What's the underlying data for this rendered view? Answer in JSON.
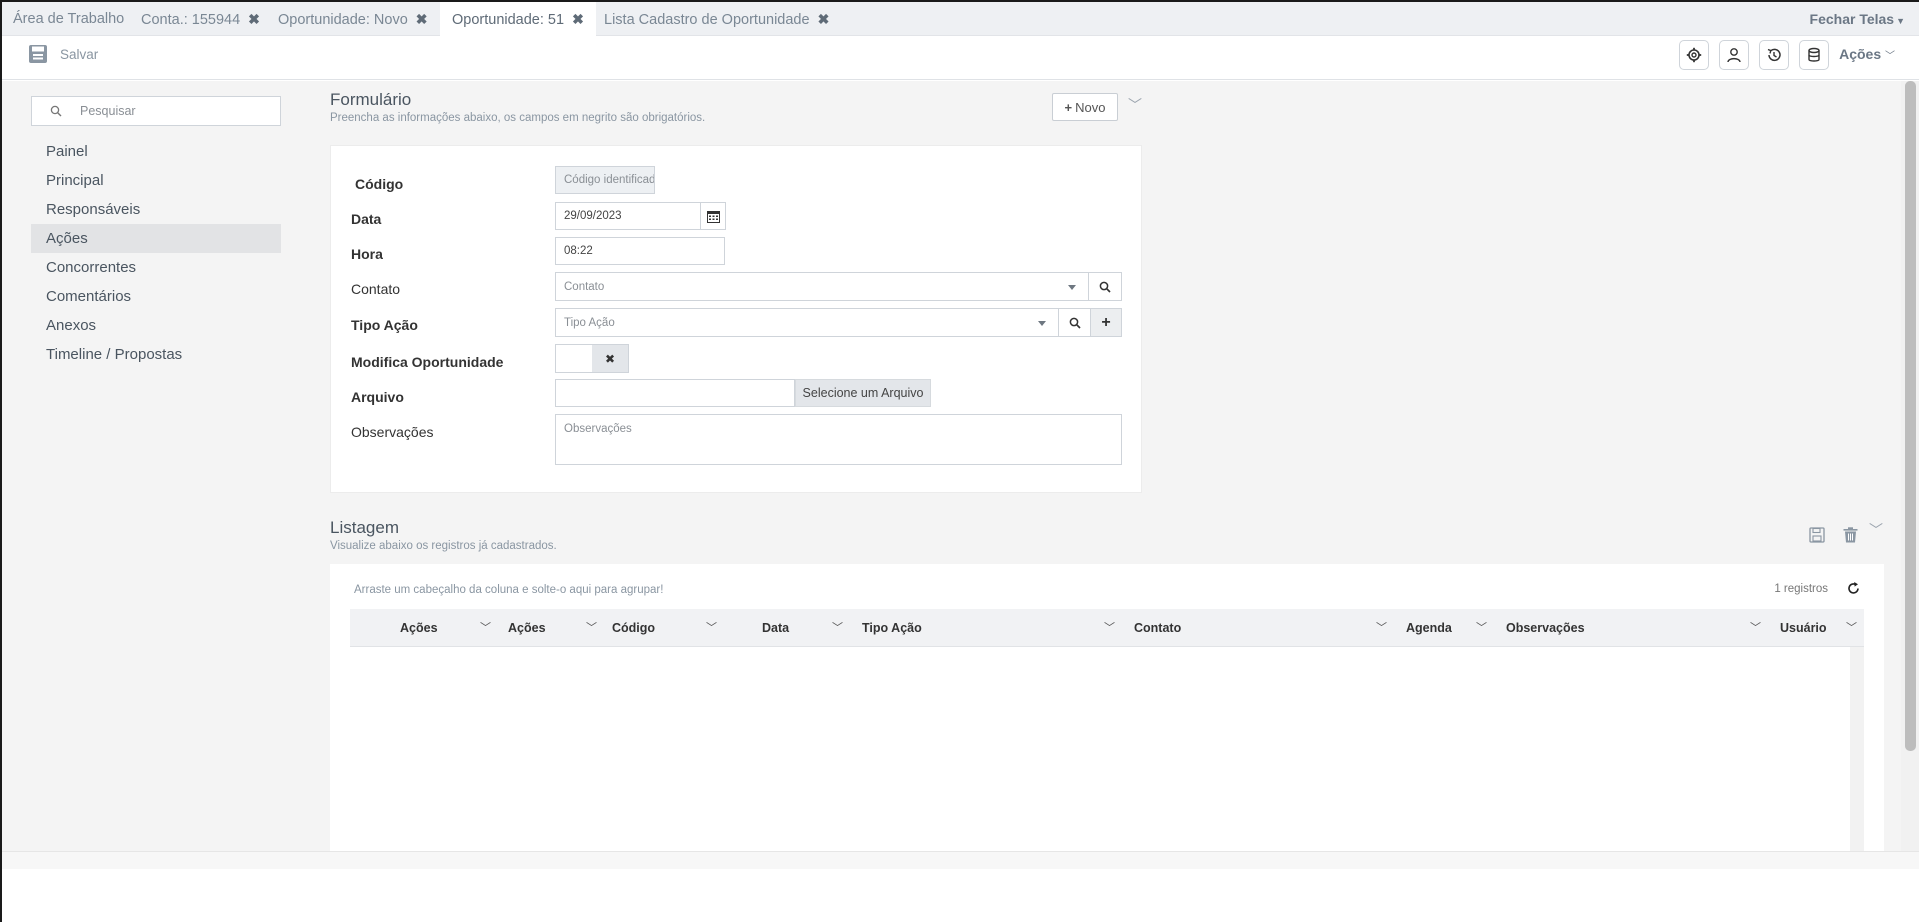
{
  "tabs": [
    {
      "label": "Área de Trabalho",
      "closable": false,
      "active": false
    },
    {
      "label": "Conta.: 155944",
      "closable": true,
      "active": false
    },
    {
      "label": "Oportunidade: Novo",
      "closable": true,
      "active": false
    },
    {
      "label": "Oportunidade: 51",
      "closable": true,
      "active": true
    },
    {
      "label": "Lista Cadastro de Oportunidade",
      "closable": true,
      "active": false
    }
  ],
  "close_all_label": "Fechar Telas",
  "toolbar": {
    "save_label": "Salvar",
    "icons": [
      "gear-icon",
      "user-icon",
      "history-icon",
      "database-icon"
    ],
    "actions_label": "Ações"
  },
  "sidebar": {
    "search_placeholder": "Pesquisar",
    "items": [
      {
        "label": "Painel",
        "active": false
      },
      {
        "label": "Principal",
        "active": false
      },
      {
        "label": "Responsáveis",
        "active": false
      },
      {
        "label": "Ações",
        "active": true
      },
      {
        "label": "Concorrentes",
        "active": false
      },
      {
        "label": "Comentários",
        "active": false
      },
      {
        "label": "Anexos",
        "active": false
      },
      {
        "label": "Timeline / Propostas",
        "active": false
      }
    ]
  },
  "form": {
    "title": "Formulário",
    "subtitle": "Preencha as informações abaixo, os campos em negrito são obrigatórios.",
    "new_button": "Novo",
    "fields": {
      "codigo": {
        "label": "Código",
        "placeholder": "Código identificador"
      },
      "data": {
        "label": "Data",
        "value": "29/09/2023"
      },
      "hora": {
        "label": "Hora",
        "value": "08:22"
      },
      "contato": {
        "label": "Contato",
        "placeholder": "Contato"
      },
      "tipo_acao": {
        "label": "Tipo Ação",
        "placeholder": "Tipo Ação"
      },
      "modifica": {
        "label": "Modifica Oportunidade",
        "value": false
      },
      "arquivo": {
        "label": "Arquivo",
        "button": "Selecione um Arquivo"
      },
      "observacoes": {
        "label": "Observações",
        "placeholder": "Observações"
      }
    }
  },
  "listing": {
    "title": "Listagem",
    "subtitle": "Visualize abaixo os registros já cadastrados.",
    "group_hint": "Arraste um cabeçalho da coluna e solte-o aqui para agrupar!",
    "record_count": "1 registros",
    "columns": [
      "Ações",
      "Ações",
      "Código",
      "Data",
      "Tipo Ação",
      "Contato",
      "Agenda",
      "Observações",
      "Usuário"
    ],
    "rows": []
  }
}
